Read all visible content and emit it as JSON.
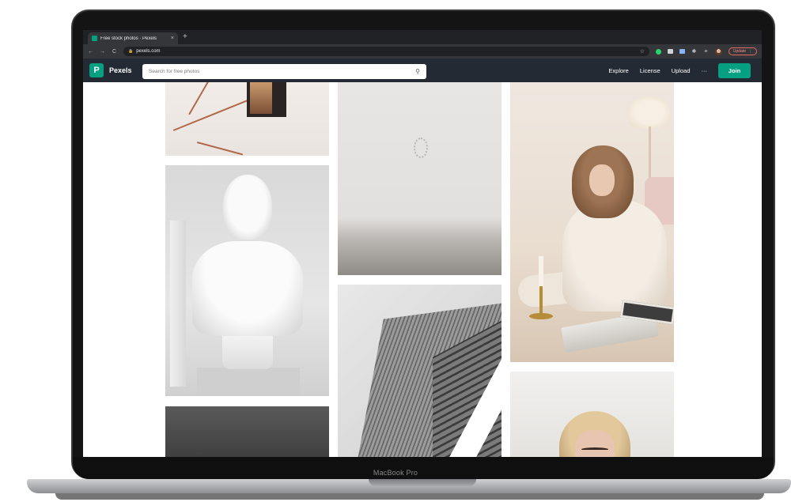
{
  "device": {
    "label": "MacBook Pro"
  },
  "browser": {
    "tab_title": "Free stock photos · Pexels",
    "tab_close": "×",
    "new_tab": "+",
    "nav": {
      "back": "←",
      "forward": "→",
      "reload": "C"
    },
    "url": "pexels.com",
    "update_label": "Update",
    "update_more": "⋮"
  },
  "header": {
    "logo_letter": "P",
    "brand": "Pexels",
    "search_placeholder": "Search for free photos",
    "nav": {
      "explore": "Explore",
      "license": "License",
      "upload": "Upload",
      "more": "···"
    },
    "join_label": "Join"
  },
  "colors": {
    "brand": "#05a081",
    "header_bg": "#232a34",
    "chrome_bg": "#35363a"
  }
}
